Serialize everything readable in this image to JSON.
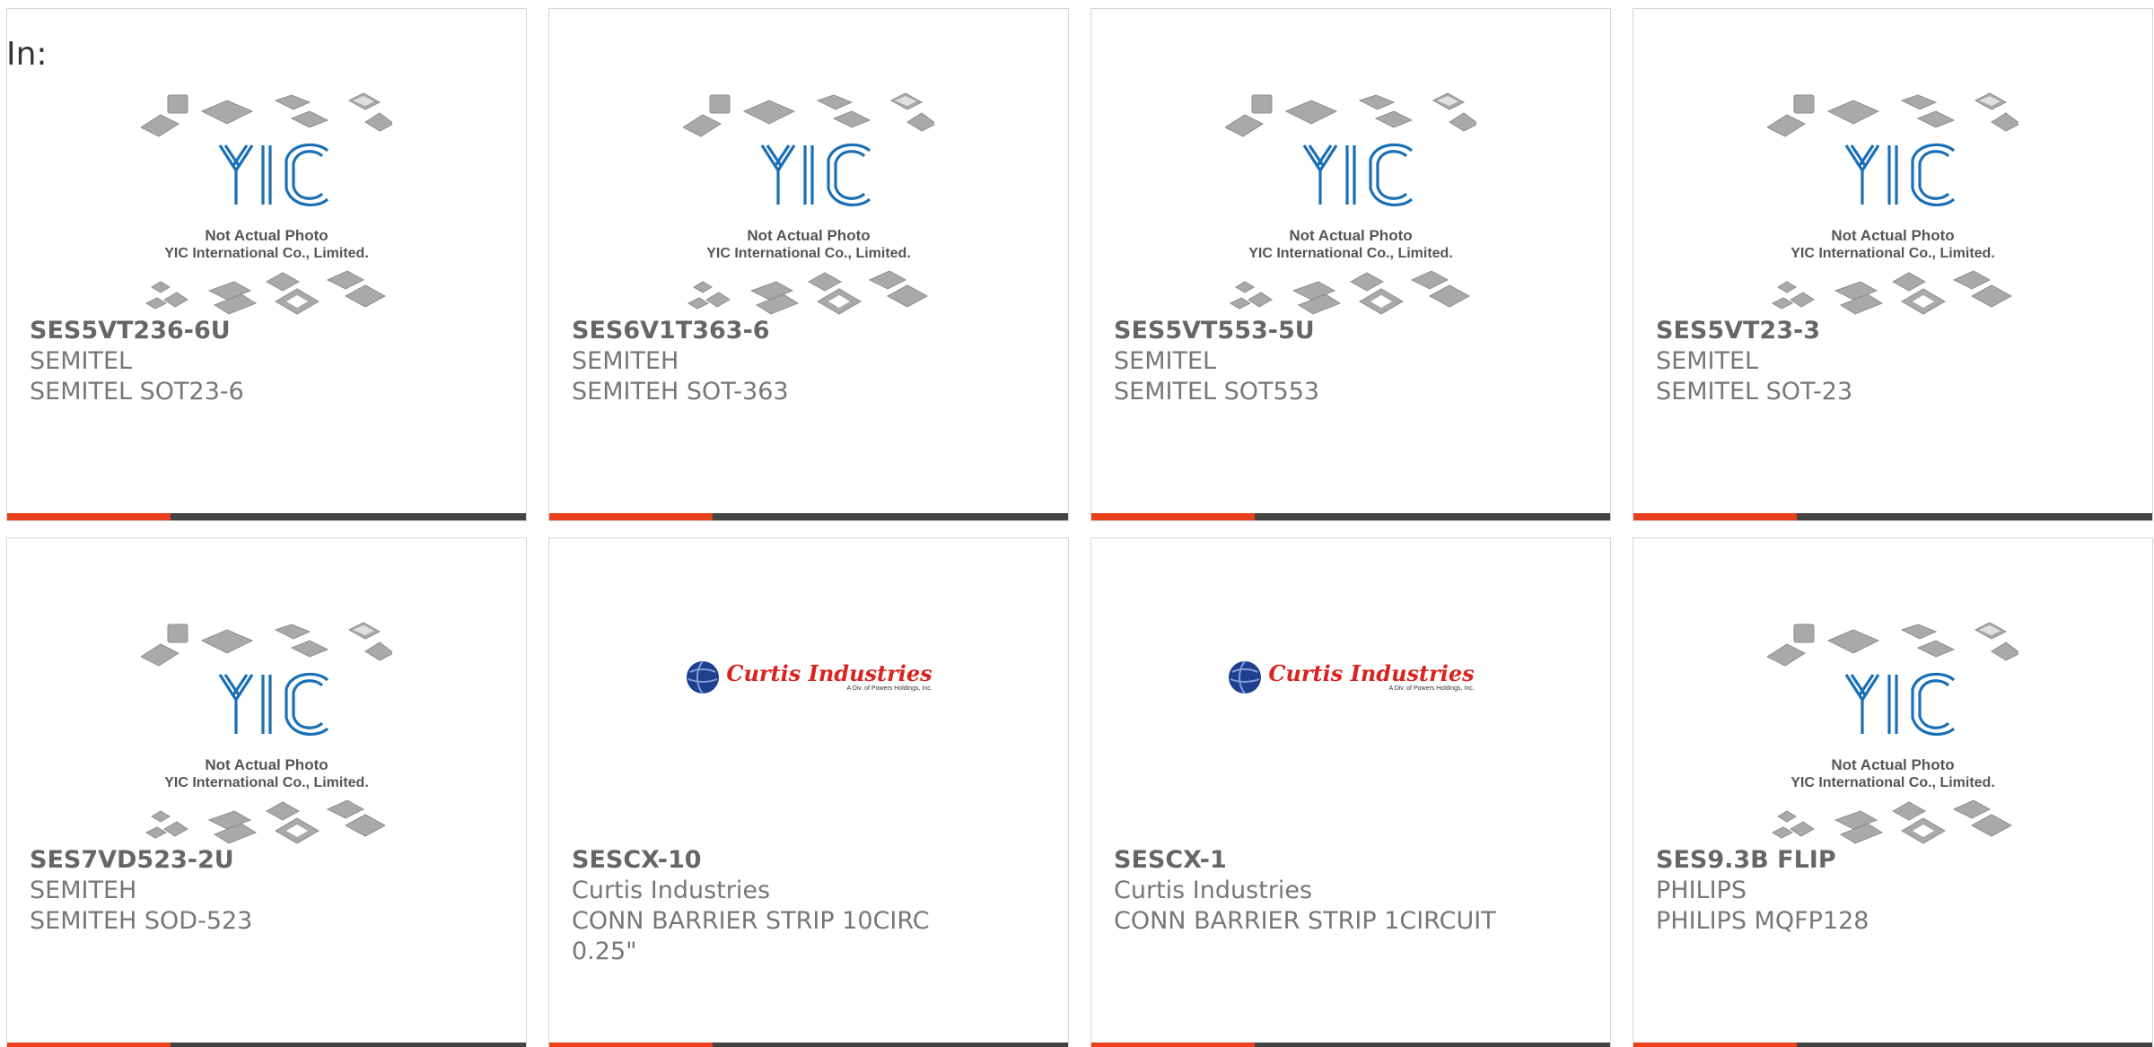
{
  "header": {
    "label": "In:"
  },
  "placeholder_image": {
    "caption_line1": "Not Actual Photo",
    "caption_line2": "YIC International Co., Limited.",
    "logo_text": "YIC"
  },
  "curtis_logo": {
    "name": "Curtis Industries",
    "subtitle": "A Div. of Powers Holdings, Inc."
  },
  "colors": {
    "accent": "#e8401c",
    "bar_dark": "#444444",
    "yic_blue": "#1a6fb5",
    "curtis_red": "#d9231f",
    "text": "#666666"
  },
  "products": [
    {
      "part": "SES5VT236-6U",
      "manufacturer": "SEMITEL",
      "description": "SEMITEL SOT23-6",
      "image": "yic-placeholder"
    },
    {
      "part": "SES6V1T363-6",
      "manufacturer": "SEMITEH",
      "description": "SEMITEH SOT-363",
      "image": "yic-placeholder"
    },
    {
      "part": "SES5VT553-5U",
      "manufacturer": "SEMITEL",
      "description": "SEMITEL SOT553",
      "image": "yic-placeholder"
    },
    {
      "part": "SES5VT23-3",
      "manufacturer": "SEMITEL",
      "description": "SEMITEL SOT-23",
      "image": "yic-placeholder"
    },
    {
      "part": "SES7VD523-2U",
      "manufacturer": "SEMITEH",
      "description": "SEMITEH SOD-523",
      "image": "yic-placeholder"
    },
    {
      "part": "SESCX-10",
      "manufacturer": "Curtis Industries",
      "description": "CONN BARRIER STRIP 10CIRC 0.25\"",
      "image": "curtis-logo"
    },
    {
      "part": "SESCX-1",
      "manufacturer": "Curtis Industries",
      "description": "CONN BARRIER STRIP 1CIRCUIT",
      "image": "curtis-logo"
    },
    {
      "part": "SES9.3B FLIP",
      "manufacturer": "PHILIPS",
      "description": "PHILIPS MQFP128",
      "image": "yic-placeholder"
    }
  ]
}
